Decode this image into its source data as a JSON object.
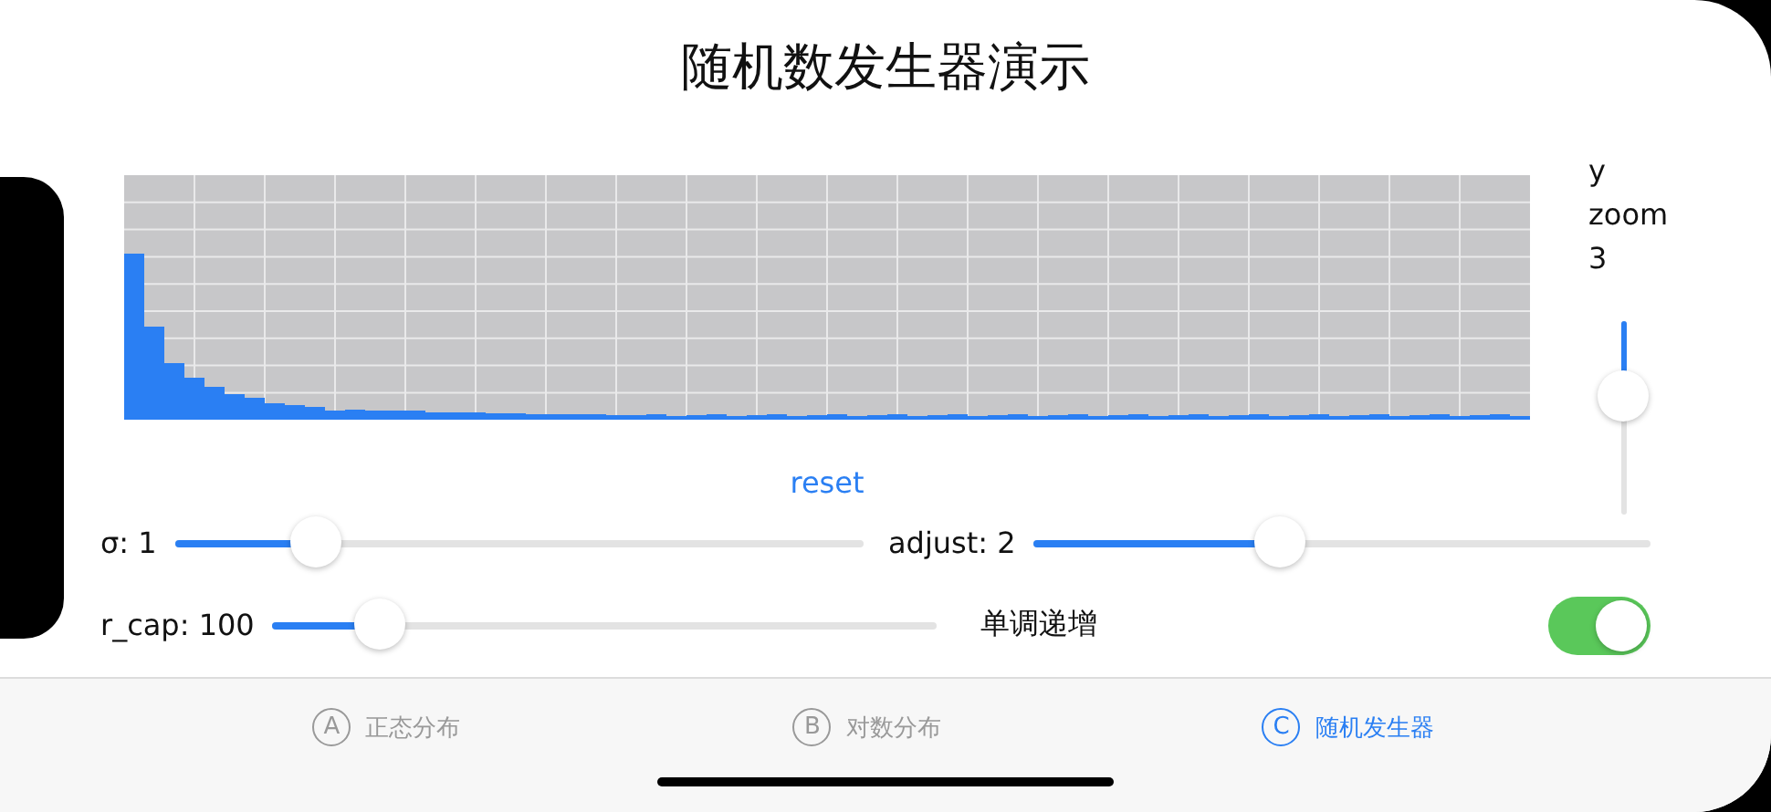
{
  "title": "随机数发生器演示",
  "y_zoom": {
    "label_lines": [
      "y",
      "zoom"
    ],
    "value": "3",
    "level": 0.35
  },
  "reset_button": "reset",
  "controls": [
    {
      "kind": "slider",
      "label": "σ: 1",
      "level": 0.18
    },
    {
      "kind": "slider",
      "label": "adjust: 2",
      "level": 0.39
    },
    {
      "kind": "slider",
      "label": "r_cap: 100",
      "level": 0.13
    },
    {
      "kind": "toggle",
      "label": "单调递增",
      "on": true
    }
  ],
  "tabs": [
    {
      "icon": "A",
      "label": "正态分布",
      "selected": false
    },
    {
      "icon": "B",
      "label": "对数分布",
      "selected": false
    },
    {
      "icon": "C",
      "label": "随机发生器",
      "selected": true
    }
  ]
}
